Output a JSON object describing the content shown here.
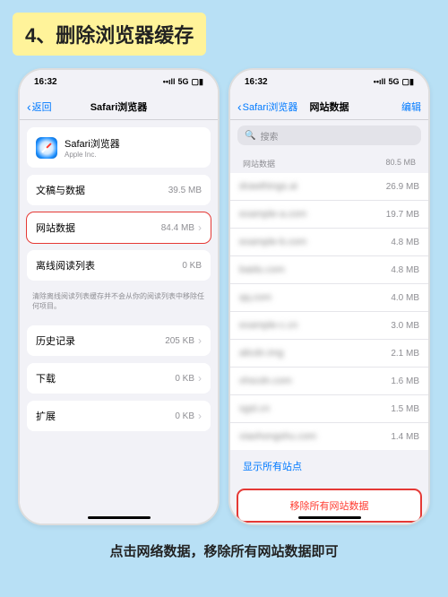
{
  "banner": "4、删除浏览器缓存",
  "caption": "点击网络数据，移除所有网站数据即可",
  "status": {
    "time": "16:32",
    "signal": "••ıll",
    "wifi": "5G",
    "battery": "▢▮"
  },
  "left": {
    "back": "返回",
    "title": "Safari浏览器",
    "app": {
      "name": "Safari浏览器",
      "vendor": "Apple Inc."
    },
    "rows": {
      "docs": {
        "label": "文稿与数据",
        "value": "39.5 MB"
      },
      "site": {
        "label": "网站数据",
        "value": "84.4 MB"
      },
      "offline": {
        "label": "离线阅读列表",
        "value": "0 KB"
      },
      "offline_note": "清除离线阅读列表缓存并不会从你的阅读列表中移除任何项目。",
      "history": {
        "label": "历史记录",
        "value": "205 KB"
      },
      "downloads": {
        "label": "下载",
        "value": "0 KB"
      },
      "extensions": {
        "label": "扩展",
        "value": "0 KB"
      }
    }
  },
  "right": {
    "back": "Safari浏览器",
    "title": "网站数据",
    "edit": "编辑",
    "search_placeholder": "搜索",
    "section": {
      "label": "网站数据",
      "total": "80.5 MB"
    },
    "sites": [
      {
        "host": "drawthings.ai",
        "size": "26.9 MB"
      },
      {
        "host": "example-a.com",
        "size": "19.7 MB"
      },
      {
        "host": "example-b.com",
        "size": "4.8 MB"
      },
      {
        "host": "baidu.com",
        "size": "4.8 MB"
      },
      {
        "host": "qq.com",
        "size": "4.0 MB"
      },
      {
        "host": "example-c.cn",
        "size": "3.0 MB"
      },
      {
        "host": "alicdn.img",
        "size": "2.1 MB"
      },
      {
        "host": "xhscdn.com",
        "size": "1.6 MB"
      },
      {
        "host": "sgsl.cn",
        "size": "1.5 MB"
      },
      {
        "host": "xiaohongshu.com",
        "size": "1.4 MB"
      }
    ],
    "show_all": "显示所有站点",
    "remove_all": "移除所有网站数据"
  }
}
